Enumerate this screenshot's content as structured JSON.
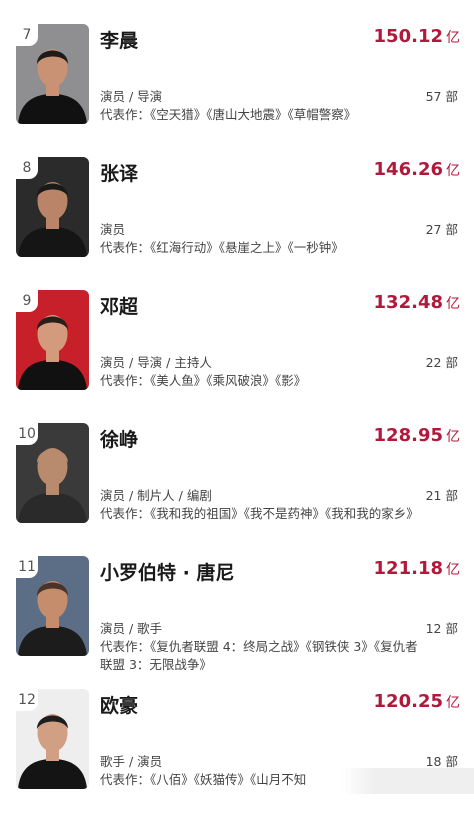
{
  "entries": [
    {
      "rank": "7",
      "name": "李晨",
      "box_value": "150.12",
      "box_unit": "亿",
      "roles": "演员 / 导演",
      "film_count": "57 部",
      "works": "代表作：《空天猎》《唐山大地震》《草帽警察》",
      "colors": {
        "bg": "#8f8e91",
        "skin": "#c99274",
        "hair": "#1c1c1c",
        "clothes": "#111111"
      }
    },
    {
      "rank": "8",
      "name": "张译",
      "box_value": "146.26",
      "box_unit": "亿",
      "roles": "演员",
      "film_count": "27 部",
      "works": "代表作：《红海行动》《悬崖之上》《一秒钟》",
      "colors": {
        "bg": "#2b2b2b",
        "skin": "#b98468",
        "hair": "#1a1a1a",
        "clothes": "#151515"
      }
    },
    {
      "rank": "9",
      "name": "邓超",
      "box_value": "132.48",
      "box_unit": "亿",
      "roles": "演员 / 导演 / 主持人",
      "film_count": "22 部",
      "works": "代表作：《美人鱼》《乘风破浪》《影》",
      "colors": {
        "bg": "#c8202a",
        "skin": "#d49a7d",
        "hair": "#2a1e18",
        "clothes": "#111111"
      }
    },
    {
      "rank": "10",
      "name": "徐峥",
      "box_value": "128.95",
      "box_unit": "亿",
      "roles": "演员 / 制片人 / 编剧",
      "film_count": "21 部",
      "works": "代表作：《我和我的祖国》《我不是药神》《我和我的家乡》",
      "colors": {
        "bg": "#3a3a3a",
        "skin": "#b88a6e",
        "hair": "#b88a6e",
        "clothes": "#2a2a2a"
      }
    },
    {
      "rank": "11",
      "name": "小罗伯特 · 唐尼",
      "box_value": "121.18",
      "box_unit": "亿",
      "roles": "演员 / 歌手",
      "film_count": "12 部",
      "works": "代表作：《复仇者联盟 4：终局之战》《钢铁侠 3》《复仇者联盟 3：无限战争》",
      "colors": {
        "bg": "#5b6e86",
        "skin": "#c58d6c",
        "hair": "#4a3328",
        "clothes": "#1c1c1c"
      }
    },
    {
      "rank": "12",
      "name": "欧豪",
      "box_value": "120.25",
      "box_unit": "亿",
      "roles": "歌手 / 演员",
      "film_count": "18 部",
      "works": "代表作：《八佰》《妖猫传》《山月不知",
      "colors": {
        "bg": "#eeeeee",
        "skin": "#d1a084",
        "hair": "#1e1e1e",
        "clothes": "#141414"
      }
    }
  ]
}
